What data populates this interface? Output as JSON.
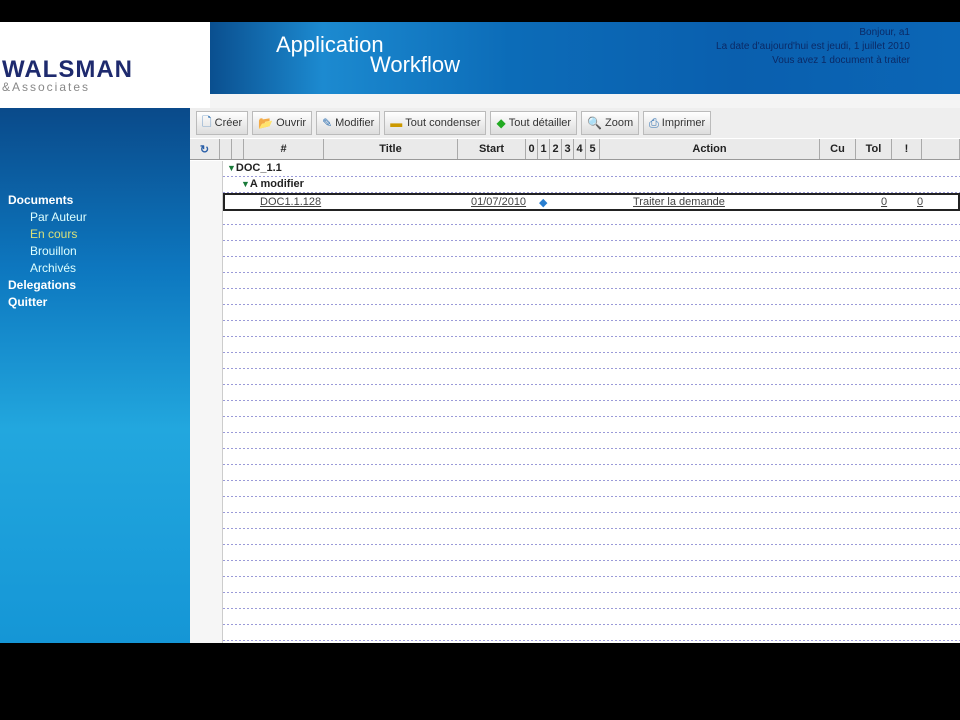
{
  "logo": {
    "line1": "WALSMAN",
    "line2": "&Associates"
  },
  "banner": {
    "title1": "Application",
    "title2": "Workflow",
    "greeting": "Bonjour, a1",
    "date": "La date d'aujourd'hui est jeudi, 1 juillet 2010",
    "pending": "Vous avez 1 document à traiter"
  },
  "sidebar": {
    "documents": "Documents",
    "par_auteur": "Par Auteur",
    "en_cours": "En cours",
    "brouillon": "Brouillon",
    "archives": "Archivés",
    "delegations": "Delegations",
    "quitter": "Quitter"
  },
  "toolbar": [
    "Créer",
    "Ouvrir",
    "Modifier",
    "Tout condenser",
    "Tout détailler",
    "Zoom",
    "Imprimer"
  ],
  "columns": {
    "num": "#",
    "title": "Title",
    "start": "Start",
    "s0": "0",
    "s1": "1",
    "s2": "2",
    "s3": "3",
    "s4": "4",
    "s5": "5",
    "action": "Action",
    "cu": "Cu",
    "tol": "Tol",
    "excl": "!"
  },
  "tree": {
    "group": "DOC_1.1",
    "subgroup": "A modifier",
    "row": {
      "id": "DOC1.1.128",
      "start": "01/07/2010",
      "action": "Traiter la demande",
      "cu": "0",
      "tol": "0"
    }
  }
}
